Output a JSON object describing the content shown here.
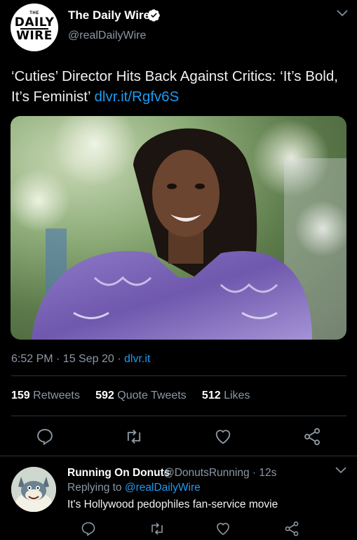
{
  "tweet": {
    "author_name": "The Daily Wire",
    "author_handle": "@realDailyWire",
    "avatar_logo": {
      "small": "THE",
      "line1": "DAILY",
      "line2": "WIRE"
    },
    "text": "‘Cuties’ Director Hits Back Against Critics: ‘It’s Bold, It’s Feminist’",
    "link": "dlvr.it/Rgfv6S",
    "timestamp": "6:52 PM · 15 Sep 20 · ",
    "source": "dlvr.it",
    "stats": {
      "retweets_count": "159",
      "retweets_label": "Retweets",
      "quote_count": "592",
      "quote_label": "Quote Tweets",
      "likes_count": "512",
      "likes_label": "Likes"
    },
    "actions": [
      "reply-icon",
      "retweet-icon",
      "like-icon",
      "share-icon"
    ]
  },
  "reply": {
    "author_name": "Running On Donuts",
    "author_handle": "@DonutsRunning · 12s",
    "replying_to_prefix": "Replying to ",
    "replying_to_handle": "@realDailyWire",
    "text": "It's Hollywood pedophiles fan-service movie",
    "actions": [
      "reply-icon",
      "retweet-icon",
      "like-icon",
      "share-icon"
    ]
  },
  "colors": {
    "background": "#000000",
    "link": "#1d9bf0",
    "muted": "#8b98a5",
    "divider": "#2f3336"
  }
}
